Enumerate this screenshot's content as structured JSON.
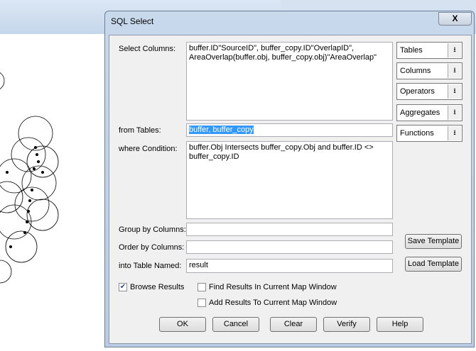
{
  "dialog": {
    "title": "SQL Select",
    "close_label": "X"
  },
  "labels": {
    "select_columns": "Select Columns:",
    "from_tables": "from Tables:",
    "where_condition": "where Condition:",
    "group_by": "Group by Columns:",
    "order_by": "Order by Columns:",
    "into_table": "into Table Named:"
  },
  "fields": {
    "select_columns": "buffer.ID\"SourceID\", buffer_copy.ID\"OverlapID\",\nAreaOverlap(buffer.obj, buffer_copy.obj)\"AreaOverlap\"",
    "from_tables": "buffer, buffer_copy",
    "where_condition": "buffer.Obj Intersects buffer_copy.Obj and buffer.ID <>\nbuffer_copy.ID",
    "group_by": "",
    "order_by": "",
    "into_table": "result"
  },
  "dropdowns": [
    "Tables",
    "Columns",
    "Operators",
    "Aggregates",
    "Functions"
  ],
  "buttons": {
    "save_template": "Save Template",
    "load_template": "Load Template",
    "ok": "OK",
    "cancel": "Cancel",
    "clear": "Clear",
    "verify": "Verify",
    "help": "Help"
  },
  "checkboxes": [
    {
      "label": "Browse Results",
      "checked": true
    },
    {
      "label": "Find Results In Current Map Window",
      "checked": false
    },
    {
      "label": "Add Results To Current Map Window",
      "checked": false
    }
  ]
}
